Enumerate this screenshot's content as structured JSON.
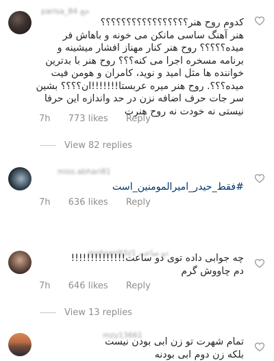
{
  "comments": [
    {
      "username": "parisa_84 حج",
      "lines": [
        "کدوم روح هنر؟؟؟؟؟؟؟؟؟؟؟؟؟؟؟؟؟",
        "هنر آهنگ ساسی مانکن می خونه و باهاش فر",
        "میده؟؟؟؟؟ روح هنر کنار مهناز افشار میشینه و",
        "برنامه مسخره اجرا می کنه؟؟؟ روح هنر با بدترین",
        "خواننده ها مثل امید و نوید، کامران و هومن فیت",
        "میده؟؟؟. روح هنر میره عربستا!!!!!!!ان؟؟؟؟ بشین",
        "سر جات حرف اضافه نزن در حد واندازه این حرفا",
        "نیستی نه خودت نه روح هنرت"
      ],
      "time": "7h",
      "likes": "773 likes",
      "reply": "Reply",
      "view_replies": "View 82 replies"
    },
    {
      "username": "miss.abhari81",
      "text": "#فقط_حیدر_امیرالمومنین_است",
      "time": "7h",
      "likes": "636 likes",
      "reply": "Reply"
    },
    {
      "username": "mohsen93z1 دو ساعت",
      "lines": [
        "چه جوابی داده توی دو ساعت!!!!!!!!!!!!!!",
        "دم چاووش گرم"
      ],
      "time": "7h",
      "likes": "646 likes",
      "reply": "Reply",
      "view_replies": "View 13 replies"
    },
    {
      "username": "mzy13661",
      "lines": [
        "تمام شهرت تو زن ابی بودن نیست",
        "بلکه زن دوم ابی بودنه"
      ]
    }
  ],
  "colors": {
    "text": "#262626",
    "muted": "#8e8e8e",
    "hashtag": "#00376b"
  },
  "icons": {
    "like": "heart-outline-icon"
  }
}
